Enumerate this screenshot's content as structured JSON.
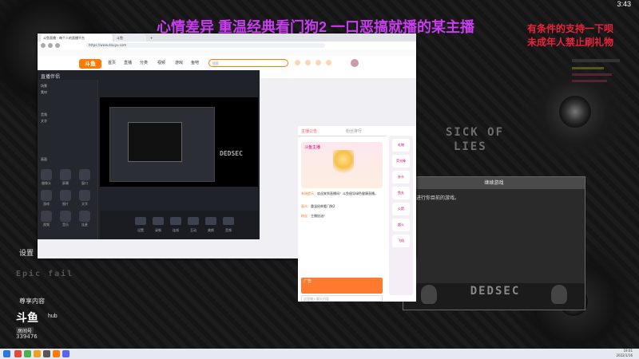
{
  "status_bar": {
    "time": "3:43"
  },
  "overlay": {
    "magenta_text": "心情差异 重温经典看门狗2 一口恶搞就播的某主播",
    "red_line1": "有条件的支持一下呗",
    "red_line2": "未成年人禁止刷礼物"
  },
  "browser": {
    "tabs": [
      "斗鱼直播 - 每个人的直播平台",
      "斗鱼",
      "+"
    ],
    "url": "https://www.douyu.com",
    "site": {
      "logo": "斗鱼",
      "nav": [
        "首页",
        "直播",
        "分类",
        "视频",
        "游戏",
        "鱼吧"
      ],
      "search_placeholder": "搜索"
    },
    "chat": {
      "tab_left": "主播公告",
      "tab_right": "粉丝排行",
      "anchor_card_title": "斗鱼主播",
      "messages": [
        {
          "nick": "系统提示：",
          "text": "欢迎来到直播间！斗鱼倡导绿色健康直播。"
        },
        {
          "nick": "观众：",
          "text": "重温经典看门狗2"
        },
        {
          "nick": "粉丝：",
          "text": "主播加油！"
        }
      ],
      "ad_text": "广告",
      "input_placeholder": "这里输入聊天内容",
      "gifts": [
        "礼物",
        "荧光棒",
        "办卡",
        "鱼丸",
        "火箭",
        "超火",
        "飞机"
      ]
    }
  },
  "obs": {
    "title": "直播伴侣",
    "left_rows": [
      "场景",
      "素材",
      "音频",
      "文字",
      "画面"
    ],
    "left_buttons": [
      "摄像头",
      "屏幕",
      "窗口",
      "游戏",
      "图片",
      "文字",
      "视频",
      "音乐",
      "连麦"
    ],
    "bottom_tools": [
      "设置",
      "录制",
      "连线",
      "互动",
      "美颜",
      "音频"
    ],
    "preview_logo": "DEDSEC"
  },
  "dialog": {
    "title": "继续游戏",
    "body": "继续进行你目前的游戏。",
    "logo": "DEDSEC"
  },
  "sidebar_overlay": {
    "settings": "设置",
    "exclusive": "尊享内容",
    "hub": "hub",
    "douyu_logo": "斗鱼",
    "room_label": "房间号",
    "room_number": "339476"
  },
  "desktop_deco": {
    "sick": "SICK OF",
    "lies": "LIES",
    "epic": "Epic fail"
  },
  "taskbar": {
    "clock_time": "19:01",
    "clock_date": "2022/1/16"
  },
  "colors": {
    "douyu_orange": "#ff7a00",
    "overlay_magenta": "#c93cf0",
    "overlay_red": "#e8233a"
  }
}
